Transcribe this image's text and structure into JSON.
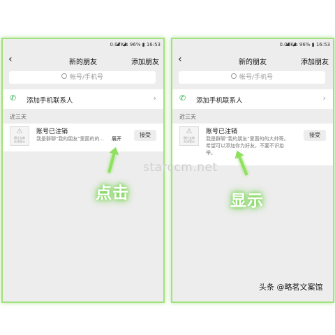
{
  "phones": [
    {
      "status": {
        "speed": "0.07K/s",
        "battery": "96%",
        "time": "16:53"
      },
      "nav": {
        "title": "新的朋友",
        "action": "添加朋友"
      },
      "search_placeholder": "帐号/手机号",
      "add_contacts_label": "添加手机联系人",
      "section_label": "近三天",
      "request": {
        "avatar_caption": "照片太帅\n无法显示",
        "name": "账号已注销",
        "message": "我是群聊\"我的朋友\"里面的的...",
        "expand_label": "展开",
        "accept_label": "接受"
      }
    },
    {
      "status": {
        "speed": "0.08K/s",
        "battery": "96%",
        "time": "16:53"
      },
      "nav": {
        "title": "新的朋友",
        "action": "添加朋友"
      },
      "search_placeholder": "帐号/手机号",
      "add_contacts_label": "添加手机联系人",
      "section_label": "近三天",
      "request": {
        "avatar_caption": "照片太帅\n无法显示",
        "name": "账号已注销",
        "message": "我是群聊\"我的朋友\"里面的的大帅哥。希望可以添加你为好友，不要不识抬举。",
        "accept_label": "接受"
      }
    }
  ],
  "annotations": {
    "left": "点击",
    "right": "显示"
  },
  "watermark": "starccm.net",
  "credit": "头条 @略茗文案馆",
  "colors": {
    "highlight": "#7ed957",
    "phone_icon": "#2fb04a",
    "background": "#ededed"
  },
  "icons": [
    "back-arrow-icon",
    "search-icon",
    "phone-icon",
    "chevron-right-icon",
    "warning-icon",
    "signal-icon",
    "wifi-icon",
    "battery-icon"
  ]
}
